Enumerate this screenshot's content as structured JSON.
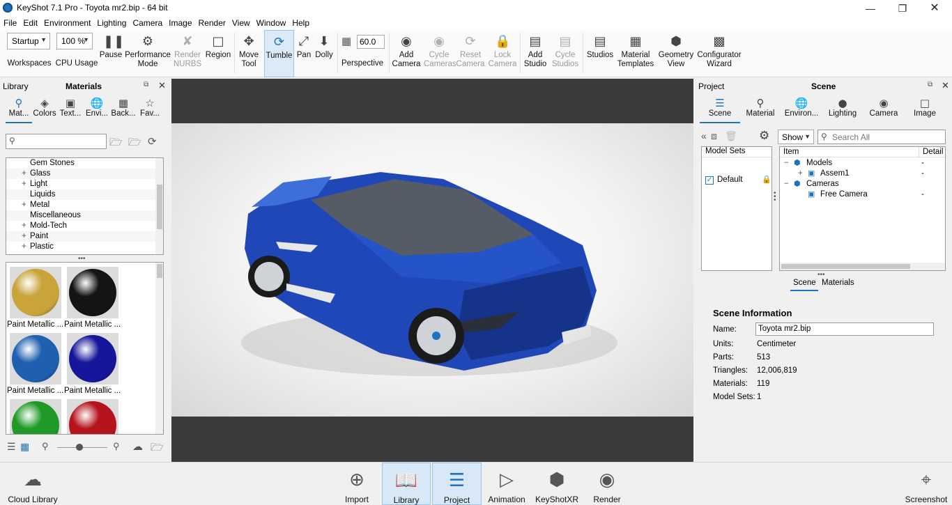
{
  "window": {
    "title": "KeyShot 7.1 Pro  -  Toyota mr2.bip  -  64 bit",
    "minimize_icon": "minimize-icon",
    "restore_icon": "restore-icon",
    "close_icon": "close-icon"
  },
  "menu": [
    "File",
    "Edit",
    "Environment",
    "Lighting",
    "Camera",
    "Image",
    "Render",
    "View",
    "Window",
    "Help"
  ],
  "toolbar": {
    "workspace_value": "Startup",
    "workspaces_label": "Workspaces",
    "cpu_value": "100 %",
    "cpu_label": "CPU Usage",
    "pause": "Pause",
    "performance": "Performance Mode",
    "render_nurbs": "Render NURBS",
    "region": "Region",
    "move_tool": "Move Tool",
    "tumble": "Tumble",
    "pan": "Pan",
    "dolly": "Dolly",
    "fov_value": "60.0",
    "perspective": "Perspective",
    "add_camera": "Add Camera",
    "cycle_cameras": "Cycle Cameras",
    "reset_camera": "Reset Camera",
    "lock_camera": "Lock Camera",
    "add_studio": "Add Studio",
    "cycle_studios": "Cycle Studios",
    "studios": "Studios",
    "material_templates": "Material Templates",
    "geometry_view": "Geometry View",
    "configurator_wizard": "Configurator Wizard"
  },
  "library": {
    "header_left": "Library",
    "header_title": "Materials",
    "tabs": [
      "Mat...",
      "Colors",
      "Text...",
      "Envi...",
      "Back...",
      "Fav..."
    ],
    "search_placeholder": "",
    "tree": [
      "Gem Stones",
      "Glass",
      "Light",
      "Liquids",
      "Metal",
      "Miscellaneous",
      "Mold-Tech",
      "Paint",
      "Plastic"
    ],
    "tree_expandable": [
      false,
      true,
      true,
      false,
      true,
      false,
      true,
      true,
      true
    ],
    "thumbs": [
      {
        "label": "Paint Metallic ...",
        "color": "#c9a43a"
      },
      {
        "label": "Paint Metallic ...",
        "color": "#141414"
      },
      {
        "label": "Paint Metallic ...",
        "color": "#1f5fb0"
      },
      {
        "label": "Paint Metallic ...",
        "color": "#16169a"
      },
      {
        "label": "",
        "color": "#1f9a26"
      },
      {
        "label": "",
        "color": "#b5141c"
      }
    ]
  },
  "project": {
    "header_left": "Project",
    "header_title": "Scene",
    "tabs": [
      "Scene",
      "Material",
      "Environ...",
      "Lighting",
      "Camera",
      "Image"
    ],
    "show_label": "Show",
    "search_placeholder": "Search All",
    "model_sets_header": "Model Sets",
    "model_set_default": "Default",
    "tree_header_item": "Item",
    "tree_header_detail": "Detail",
    "tree": [
      {
        "label": "Models",
        "detail": "-",
        "indent": 0,
        "sign": "−"
      },
      {
        "label": "Assem1",
        "detail": "-",
        "indent": 1,
        "sign": "+"
      },
      {
        "label": "Cameras",
        "detail": "",
        "indent": 0,
        "sign": "−"
      },
      {
        "label": "Free Camera",
        "detail": "-",
        "indent": 1,
        "sign": ""
      }
    ],
    "subtabs": [
      "Scene",
      "Materials"
    ],
    "info_title": "Scene Information",
    "info": {
      "name_label": "Name:",
      "name_value": "Toyota mr2.bip",
      "units_label": "Units:",
      "units_value": "Centimeter",
      "parts_label": "Parts:",
      "parts_value": "513",
      "triangles_label": "Triangles:",
      "triangles_value": "12,006,819",
      "materials_label": "Materials:",
      "materials_value": "119",
      "modelsets_label": "Model Sets:",
      "modelsets_value": "1"
    }
  },
  "bottombar": {
    "cloud_library": "Cloud Library",
    "import": "Import",
    "library": "Library",
    "project": "Project",
    "animation": "Animation",
    "keyshotxr": "KeyShotXR",
    "render": "Render",
    "screenshot": "Screenshot"
  },
  "colors": {
    "accent": "#1e73be",
    "car_body": "#1f47b8"
  }
}
